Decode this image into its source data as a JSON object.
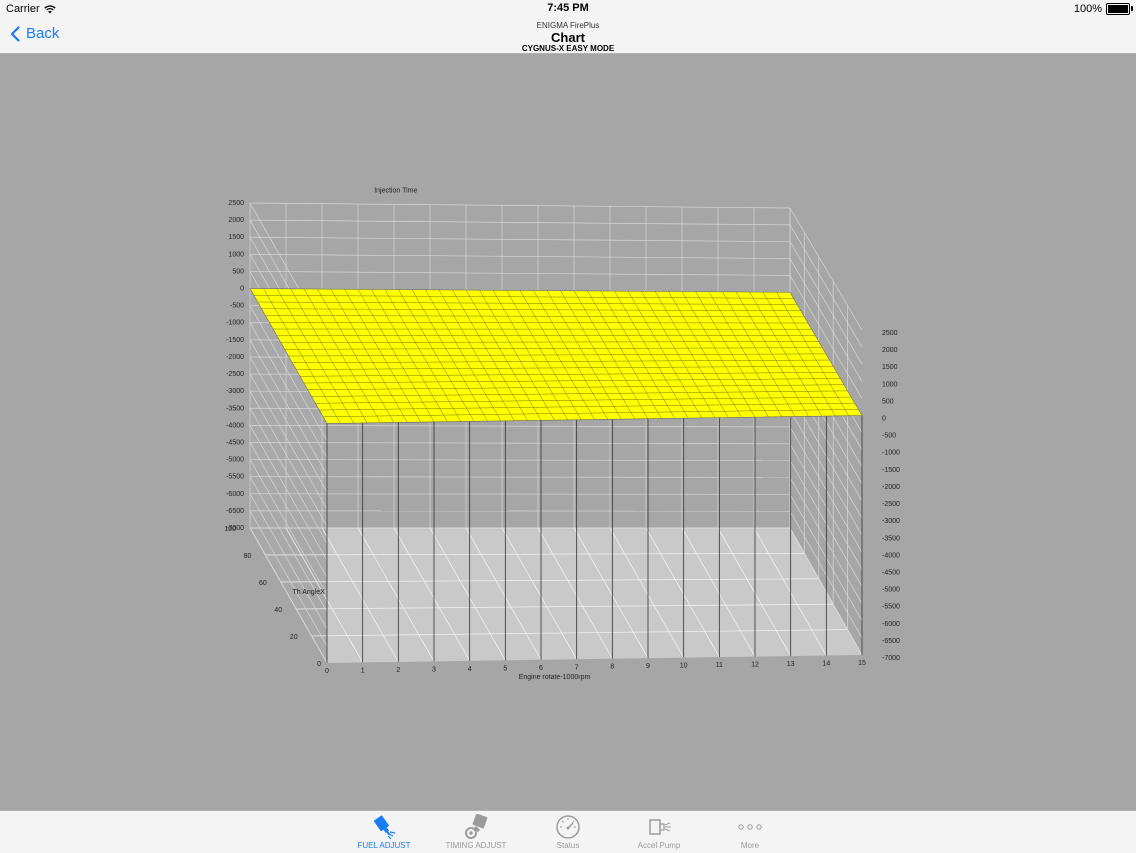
{
  "status_bar": {
    "carrier": "Carrier",
    "time": "7:45 PM",
    "battery": "100%",
    "battery_level": 1.0
  },
  "nav": {
    "back_label": "Back",
    "app_name": "ENIGMA FirePlus",
    "title": "Chart",
    "subtitle": "CYGNUS-X EASY MODE"
  },
  "tabs": [
    {
      "label": "FUEL ADJUST",
      "icon": "fuel-injector-icon",
      "active": true
    },
    {
      "label": "TIMING ADJUST",
      "icon": "timing-icon",
      "active": false
    },
    {
      "label": "Status",
      "icon": "gauge-icon",
      "active": false
    },
    {
      "label": "Accel Pump",
      "icon": "accel-pump-icon",
      "active": false
    },
    {
      "label": "More",
      "icon": "more-dots-icon",
      "active": false
    }
  ],
  "chart_data": {
    "type": "surface3d",
    "title": "Injection Time",
    "xlabel": "Engine rotate-1000rpm",
    "ylabel": "Th AngleX",
    "x_ticks": [
      "0",
      "1",
      "2",
      "3",
      "4",
      "5",
      "6",
      "7",
      "8",
      "9",
      "10",
      "11",
      "12",
      "13",
      "14",
      "15"
    ],
    "y_ticks": [
      "20",
      "40",
      "60",
      "80",
      "100"
    ],
    "z_ticks_left": [
      "2500",
      "2000",
      "1500",
      "1000",
      "500",
      "0",
      "-500",
      "-1000",
      "-1500",
      "-2000",
      "-2500",
      "-3000",
      "-3500",
      "-4000",
      "-4500",
      "-5000",
      "-5500",
      "-6000",
      "-6500",
      "-7000"
    ],
    "z_ticks_right": [
      "2500",
      "2000",
      "1500",
      "1000",
      "500",
      "0",
      "-500",
      "-1000",
      "-1500",
      "-2000",
      "-2500",
      "-3000",
      "-3500",
      "-4000",
      "-4500",
      "-5000",
      "-5500",
      "-6000",
      "-6500",
      "-7000"
    ],
    "xlim": [
      0,
      15
    ],
    "ylim": [
      0,
      100
    ],
    "zlim": [
      -7000,
      2500
    ],
    "surface_value": 0,
    "surface_color": "#ffff00",
    "grid": true
  },
  "colors": {
    "accent": "#1a7cf5",
    "background": "#a6a6a6",
    "surface": "#ffff00"
  }
}
